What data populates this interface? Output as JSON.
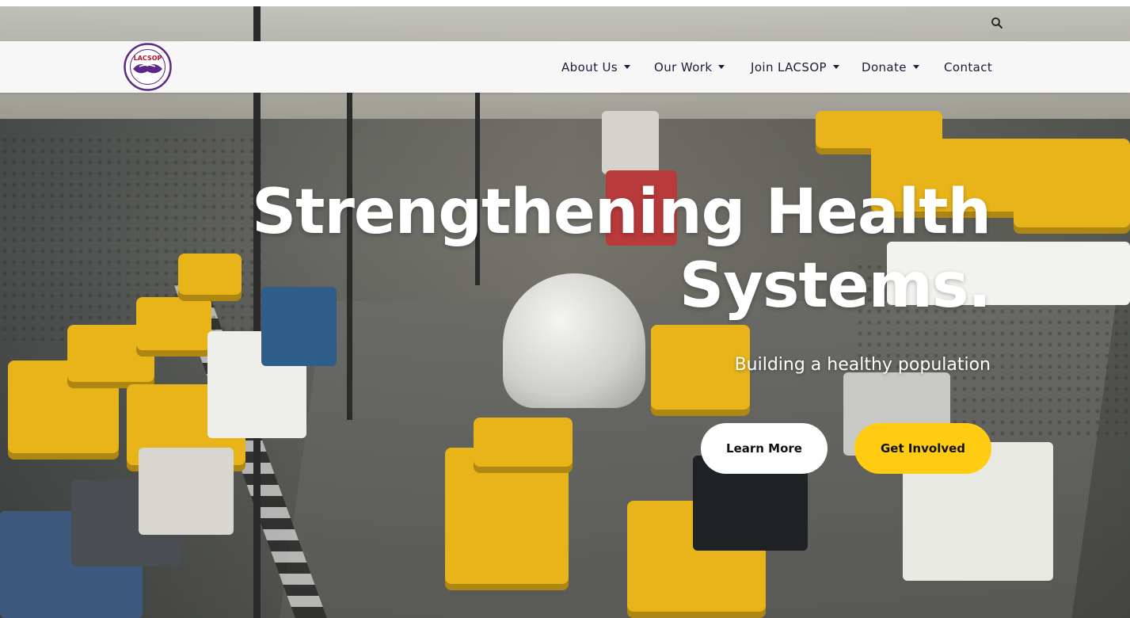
{
  "header": {
    "logo_alt": "LACSOP",
    "logo_text": "LACSOP"
  },
  "nav": {
    "items": [
      {
        "label": "About Us",
        "has_dropdown": true
      },
      {
        "label": "Our Work",
        "has_dropdown": true
      },
      {
        "label": "Join LACSOP",
        "has_dropdown": true
      },
      {
        "label": "Donate",
        "has_dropdown": true
      },
      {
        "label": "Contact",
        "has_dropdown": false
      }
    ]
  },
  "icons": {
    "search": "search-icon",
    "caret": "caret-down-icon"
  },
  "hero": {
    "headline_line1": "Strengthening Health",
    "headline_line2": "Systems.",
    "subheading": "Building a healthy population",
    "buttons": {
      "learn_more": "Learn More",
      "get_involved": "Get Involved"
    }
  },
  "colors": {
    "nav_bg": "#f7f7f7",
    "nav_text": "#1d1a3a",
    "accent_yellow": "#ffcc12",
    "logo_purple": "#5b2a86",
    "logo_red": "#b3122a"
  }
}
